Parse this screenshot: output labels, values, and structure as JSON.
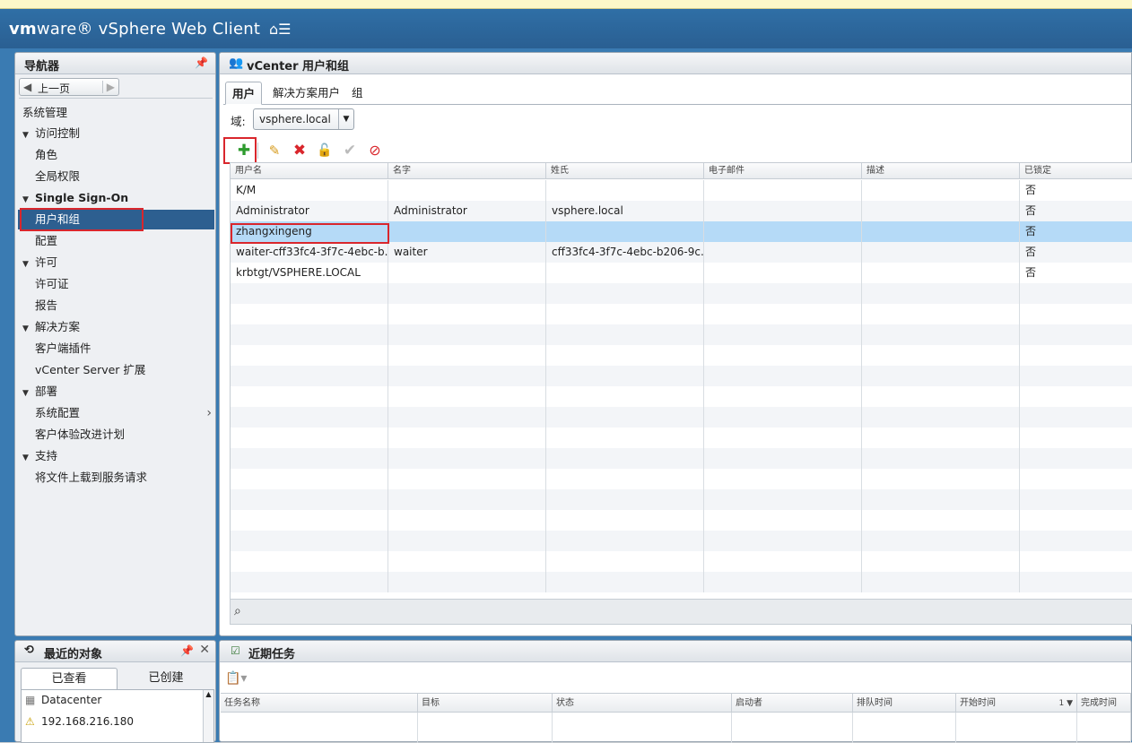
{
  "header": {
    "brand_vm": "vm",
    "brand_ware": "ware",
    "brand_product": "vSphere Web Client",
    "home_icon": "home-menu-icon"
  },
  "navigator": {
    "title": "导航器",
    "back_label": "上一页",
    "items": [
      {
        "label": "系统管理",
        "level": 0
      },
      {
        "label": "访问控制",
        "level": 1,
        "expanded": true
      },
      {
        "label": "角色",
        "level": 2
      },
      {
        "label": "全局权限",
        "level": 2
      },
      {
        "label": "Single Sign-On",
        "level": 1,
        "expanded": true
      },
      {
        "label": "用户和组",
        "level": 2,
        "selected": true
      },
      {
        "label": "配置",
        "level": 2
      },
      {
        "label": "许可",
        "level": 1,
        "expanded": true
      },
      {
        "label": "许可证",
        "level": 2
      },
      {
        "label": "报告",
        "level": 2
      },
      {
        "label": "解决方案",
        "level": 1,
        "expanded": true
      },
      {
        "label": "客户端插件",
        "level": 2
      },
      {
        "label": "vCenter Server 扩展",
        "level": 2
      },
      {
        "label": "部署",
        "level": 1,
        "expanded": true
      },
      {
        "label": "系统配置",
        "level": 2
      },
      {
        "label": "客户体验改进计划",
        "level": 2
      },
      {
        "label": "支持",
        "level": 1,
        "expanded": true
      },
      {
        "label": "将文件上载到服务请求",
        "level": 2
      }
    ]
  },
  "main": {
    "title": "vCenter 用户和组",
    "tabs": [
      "用户",
      "解决方案用户",
      "组"
    ],
    "domain_label": "域:",
    "domain_value": "vsphere.local",
    "columns": [
      "用户名",
      "名字",
      "姓氏",
      "电子邮件",
      "描述",
      "已锁定"
    ],
    "rows": [
      [
        "K/M",
        "",
        "",
        "",
        "",
        "否"
      ],
      [
        "Administrator",
        "Administrator",
        "vsphere.local",
        "",
        "",
        "否"
      ],
      [
        "zhangxingeng",
        "",
        "",
        "",
        "",
        "否"
      ],
      [
        "waiter-cff33fc4-3f7c-4ebc-b...",
        "waiter",
        "cff33fc4-3f7c-4ebc-b206-9c...",
        "",
        "",
        "否"
      ],
      [
        "krbtgt/VSPHERE.LOCAL",
        "",
        "",
        "",
        "",
        "否"
      ]
    ],
    "selected_row": 2
  },
  "recent_objects": {
    "title": "最近的对象",
    "tabs": [
      "已查看",
      "已创建"
    ],
    "items": [
      {
        "label": "Datacenter",
        "icon": "datacenter-icon"
      },
      {
        "label": "192.168.216.180",
        "icon": "host-warning-icon"
      }
    ]
  },
  "recent_tasks": {
    "title": "近期任务",
    "columns": [
      "任务名称",
      "目标",
      "状态",
      "启动者",
      "排队时间",
      "开始时间",
      "完成时间"
    ],
    "sort_indicator": "1 ▼"
  },
  "colors": {
    "header_blue": "#2f6fa6",
    "selection_blue": "#2d5f90",
    "row_selected": "#b5daf7",
    "highlight_red": "#d9262c",
    "add_green": "#2e9b2e"
  }
}
